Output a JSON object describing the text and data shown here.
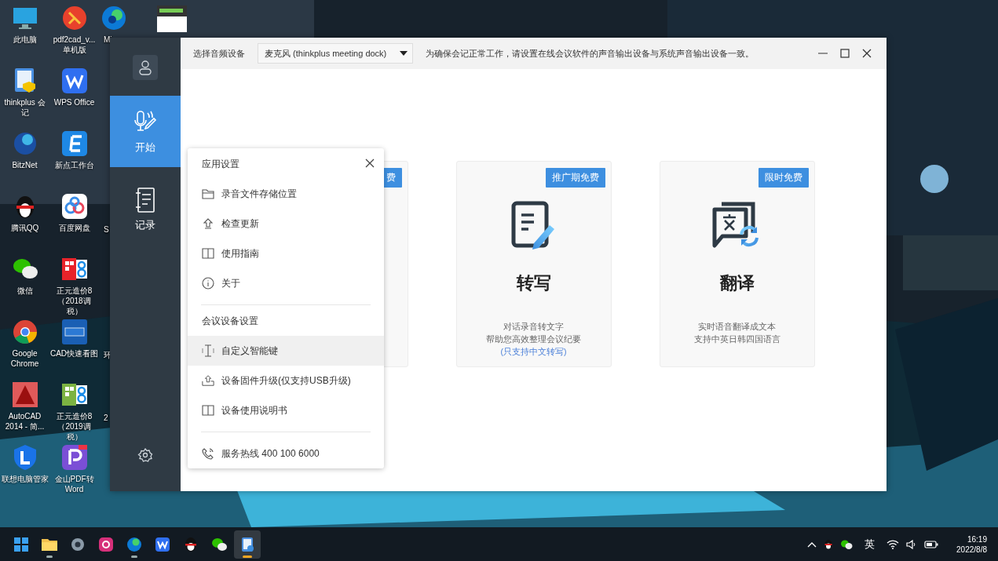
{
  "desktop": {
    "columns": [
      [
        {
          "label": "此电脑"
        },
        {
          "label": "thinkplus 会记"
        },
        {
          "label": "BitzNet"
        },
        {
          "label": "腾讯QQ"
        },
        {
          "label": "微信"
        },
        {
          "label": "Google Chrome"
        },
        {
          "label": "AutoCAD 2014 - 简..."
        },
        {
          "label": "联想电脑管家"
        }
      ],
      [
        {
          "label": "pdf2cad_v... 单机版"
        },
        {
          "label": "WPS Office"
        },
        {
          "label": "新点工作台"
        },
        {
          "label": "百度网盘"
        },
        {
          "label": "正元造价8（2018调税）"
        },
        {
          "label": "CAD快速看图"
        },
        {
          "label": "正元造价8（2019调税）"
        },
        {
          "label": "金山PDF转Word"
        }
      ],
      [
        {
          "label": "Mi"
        },
        {
          "label": "S"
        },
        {
          "label": "环"
        },
        {
          "label": "2"
        }
      ]
    ]
  },
  "window": {
    "nav": [
      {
        "label": "开始",
        "selected": true
      },
      {
        "label": "记录",
        "selected": false
      }
    ],
    "device_label": "选择音频设备",
    "device_select": {
      "value": "麦克风 (thinkplus meeting dock)"
    },
    "notice": "为确保会记正常工作，请设置在线会议软件的声音输出设备与系统声音输出设备一致。",
    "cards": [
      {
        "badge": "费"
      },
      {
        "badge": "推广期免费",
        "title": "转写",
        "description": [
          "对话录音转文字",
          "帮助您高效整理会议纪要"
        ],
        "note": "(只支持中文转写)"
      },
      {
        "badge": "限时免费",
        "title": "翻译",
        "description": [
          "实时语音翻译成文本",
          "支持中英日韩四国语言"
        ]
      }
    ]
  },
  "settings_menu": {
    "sections": [
      {
        "title": "应用设置",
        "items": [
          {
            "label": "录音文件存储位置",
            "selected": false
          },
          {
            "label": "检查更新",
            "selected": false
          },
          {
            "label": "使用指南",
            "selected": false
          },
          {
            "label": "关于",
            "selected": false
          }
        ]
      },
      {
        "title": "会议设备设置",
        "items": [
          {
            "label": "自定义智能键",
            "selected": true
          },
          {
            "label": "设备固件升级(仅支持USB升级)",
            "selected": false
          },
          {
            "label": "设备使用说明书",
            "selected": false
          }
        ]
      }
    ],
    "hotline": "服务热线 400 100 6000"
  },
  "taskbar": {
    "apps": [
      {
        "running": false,
        "selected": false
      },
      {
        "running": true,
        "selected": false
      },
      {
        "running": false,
        "selected": false
      },
      {
        "running": false,
        "selected": false
      },
      {
        "running": true,
        "selected": false
      },
      {
        "running": false,
        "selected": false
      },
      {
        "running": false,
        "selected": false
      },
      {
        "running": false,
        "selected": false
      },
      {
        "running": true,
        "selected": true
      }
    ],
    "tray": {
      "ime": "英",
      "time": "16:19",
      "date": "2022/8/8"
    }
  }
}
